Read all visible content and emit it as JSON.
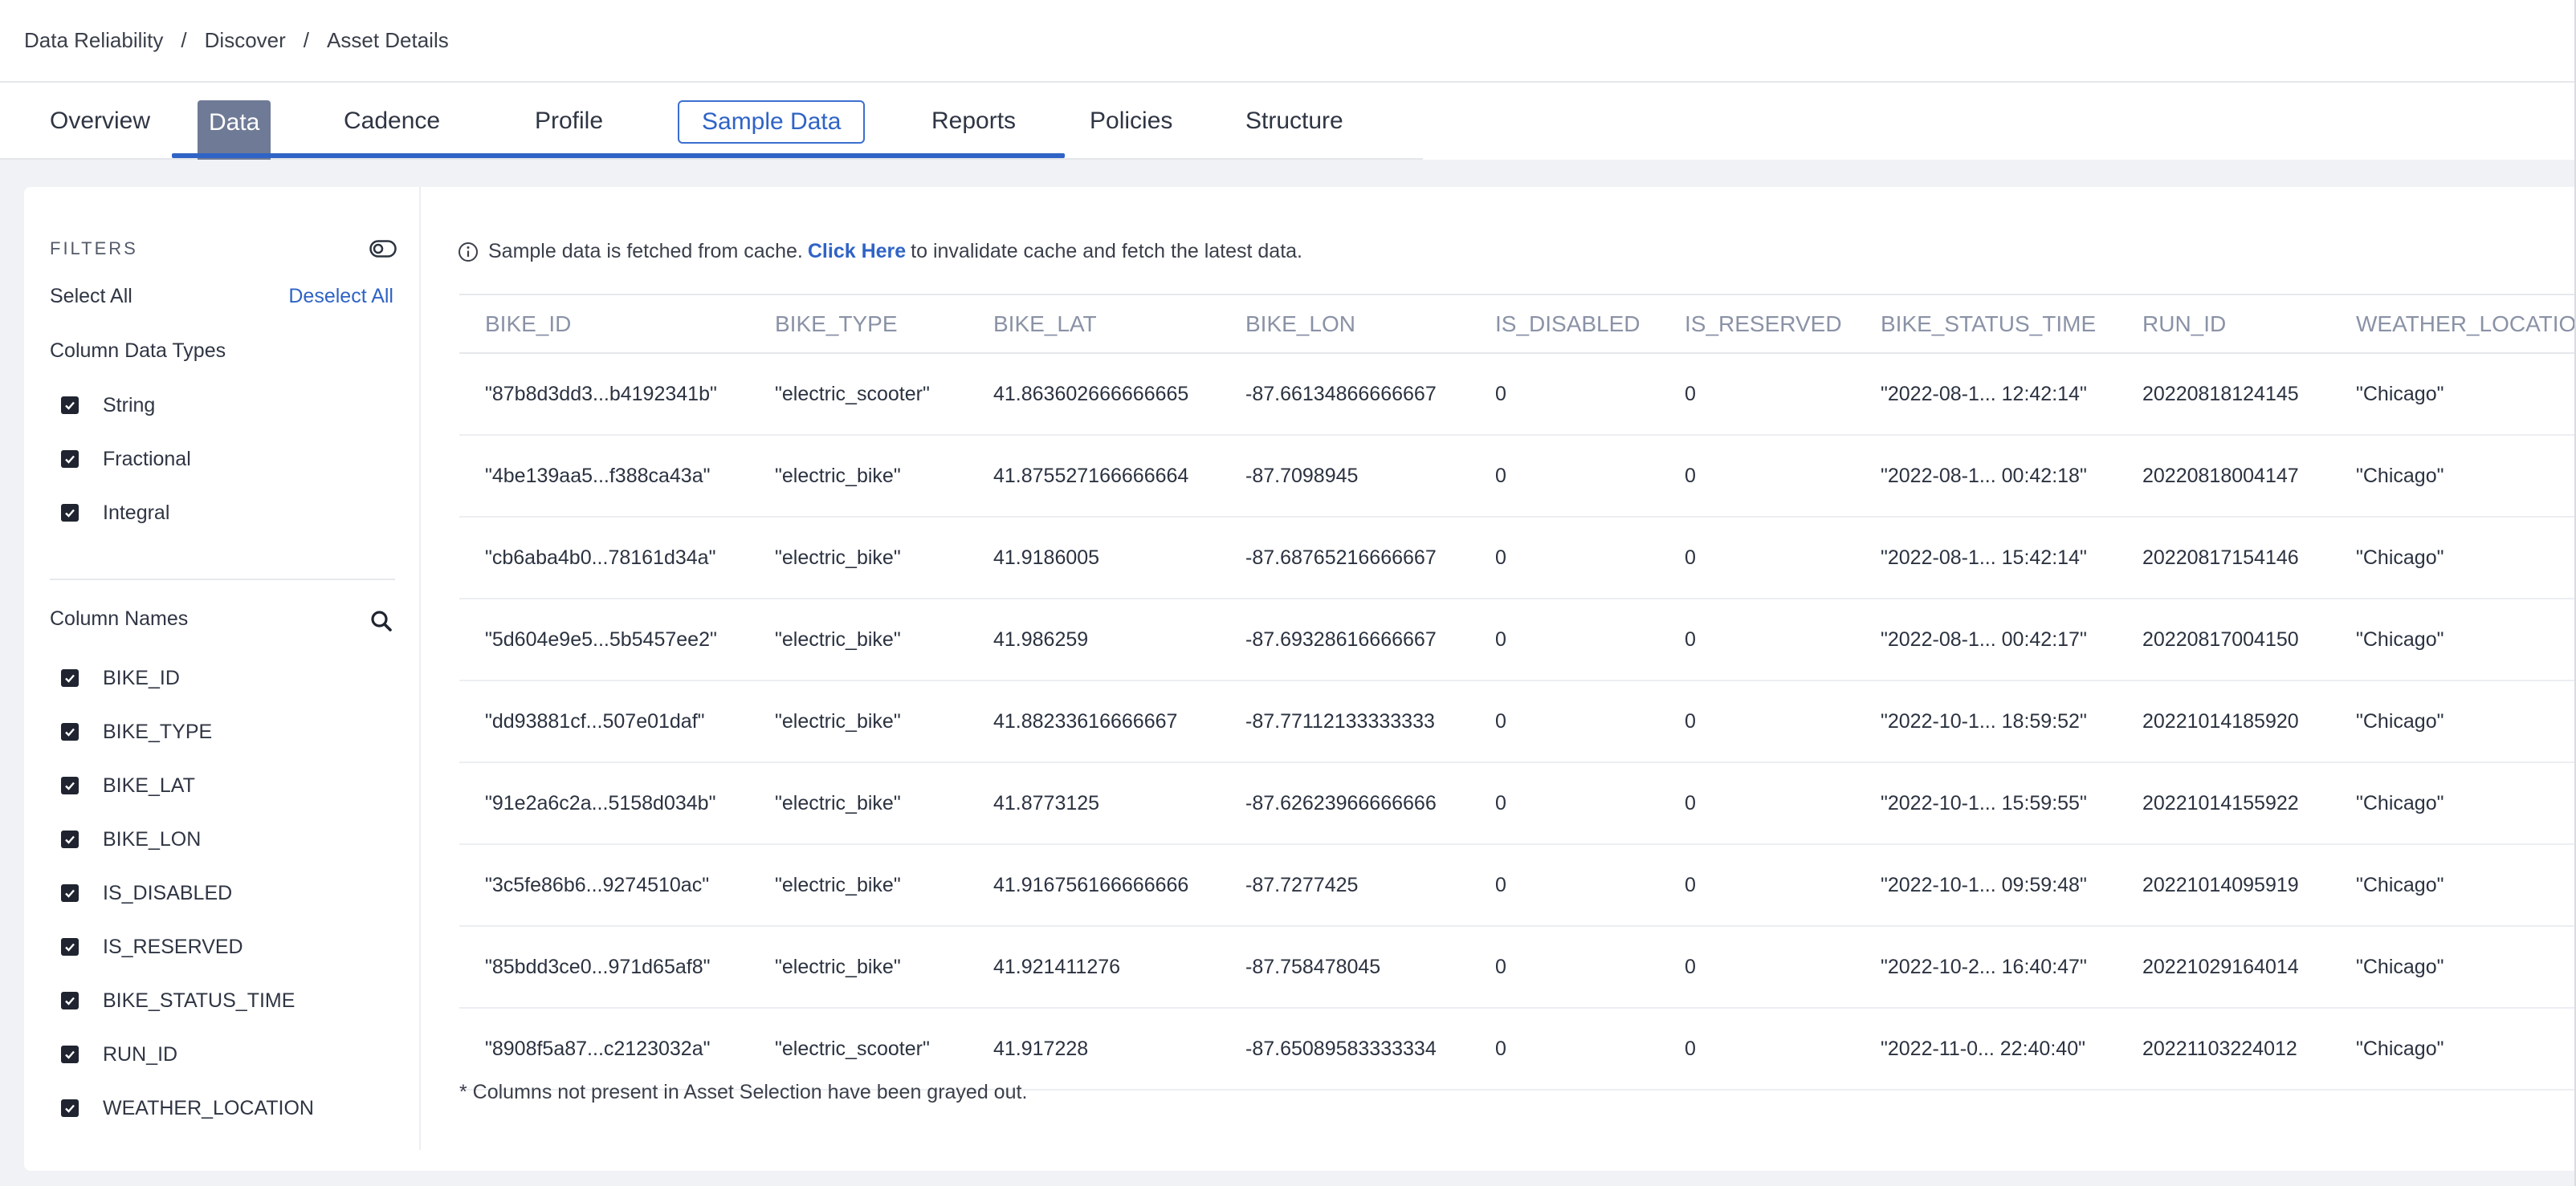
{
  "breadcrumb": [
    "Data Reliability",
    "Discover",
    "Asset Details"
  ],
  "tabs": [
    {
      "label": "Overview"
    },
    {
      "label": "Data"
    },
    {
      "label": "Cadence"
    },
    {
      "label": "Profile"
    },
    {
      "label": "Sample Data"
    },
    {
      "label": "Reports"
    },
    {
      "label": "Policies"
    },
    {
      "label": "Structure"
    }
  ],
  "filters": {
    "title": "FILTERS",
    "select_all": "Select All",
    "deselect_all": "Deselect All",
    "data_types_label": "Column Data Types",
    "data_types": [
      {
        "label": "String",
        "checked": true
      },
      {
        "label": "Fractional",
        "checked": true
      },
      {
        "label": "Integral",
        "checked": true
      }
    ],
    "names_label": "Column Names",
    "names": [
      {
        "label": "BIKE_ID",
        "checked": true
      },
      {
        "label": "BIKE_TYPE",
        "checked": true
      },
      {
        "label": "BIKE_LAT",
        "checked": true
      },
      {
        "label": "BIKE_LON",
        "checked": true
      },
      {
        "label": "IS_DISABLED",
        "checked": true
      },
      {
        "label": "IS_RESERVED",
        "checked": true
      },
      {
        "label": "BIKE_STATUS_TIME",
        "checked": true
      },
      {
        "label": "RUN_ID",
        "checked": true
      },
      {
        "label": "WEATHER_LOCATION",
        "checked": true
      }
    ],
    "icons": {
      "toggle": "toggle-icon",
      "search": "search-icon"
    }
  },
  "info": {
    "prefix": "Sample data is fetched from cache.",
    "link": "Click Here",
    "suffix": "to invalidate cache and fetch the latest data.",
    "icon": "info-icon"
  },
  "table": {
    "columns": [
      "BIKE_ID",
      "BIKE_TYPE",
      "BIKE_LAT",
      "BIKE_LON",
      "IS_DISABLED",
      "IS_RESERVED",
      "BIKE_STATUS_TIME",
      "RUN_ID",
      "WEATHER_LOCATION"
    ],
    "rows": [
      [
        "\"87b8d3dd3...b4192341b\"",
        "\"electric_scooter\"",
        "41.863602666666665",
        "-87.66134866666667",
        "0",
        "0",
        "\"2022-08-1... 12:42:14\"",
        "20220818124145",
        "\"Chicago\""
      ],
      [
        "\"4be139aa5...f388ca43a\"",
        "\"electric_bike\"",
        "41.875527166666664",
        "-87.7098945",
        "0",
        "0",
        "\"2022-08-1... 00:42:18\"",
        "20220818004147",
        "\"Chicago\""
      ],
      [
        "\"cb6aba4b0...78161d34a\"",
        "\"electric_bike\"",
        "41.9186005",
        "-87.68765216666667",
        "0",
        "0",
        "\"2022-08-1... 15:42:14\"",
        "20220817154146",
        "\"Chicago\""
      ],
      [
        "\"5d604e9e5...5b5457ee2\"",
        "\"electric_bike\"",
        "41.986259",
        "-87.69328616666667",
        "0",
        "0",
        "\"2022-08-1... 00:42:17\"",
        "20220817004150",
        "\"Chicago\""
      ],
      [
        "\"dd93881cf...507e01daf\"",
        "\"electric_bike\"",
        "41.88233616666667",
        "-87.77112133333333",
        "0",
        "0",
        "\"2022-10-1... 18:59:52\"",
        "20221014185920",
        "\"Chicago\""
      ],
      [
        "\"91e2a6c2a...5158d034b\"",
        "\"electric_bike\"",
        "41.8773125",
        "-87.62623966666666",
        "0",
        "0",
        "\"2022-10-1... 15:59:55\"",
        "20221014155922",
        "\"Chicago\""
      ],
      [
        "\"3c5fe86b6...9274510ac\"",
        "\"electric_bike\"",
        "41.916756166666666",
        "-87.7277425",
        "0",
        "0",
        "\"2022-10-1... 09:59:48\"",
        "20221014095919",
        "\"Chicago\""
      ],
      [
        "\"85bdd3ce0...971d65af8\"",
        "\"electric_bike\"",
        "41.921411276",
        "-87.758478045",
        "0",
        "0",
        "\"2022-10-2... 16:40:47\"",
        "20221029164014",
        "\"Chicago\""
      ],
      [
        "\"8908f5a87...c2123032a\"",
        "\"electric_scooter\"",
        "41.917228",
        "-87.65089583333334",
        "0",
        "0",
        "\"2022-11-0... 22:40:40\"",
        "20221103224012",
        "\"Chicago\""
      ]
    ]
  },
  "footnote": "* Columns not present in Asset Selection have been grayed out.",
  "colors": {
    "accent": "#2f63c6",
    "active_tab_bg": "#6f7a96",
    "header_text": "#8a92a6"
  }
}
